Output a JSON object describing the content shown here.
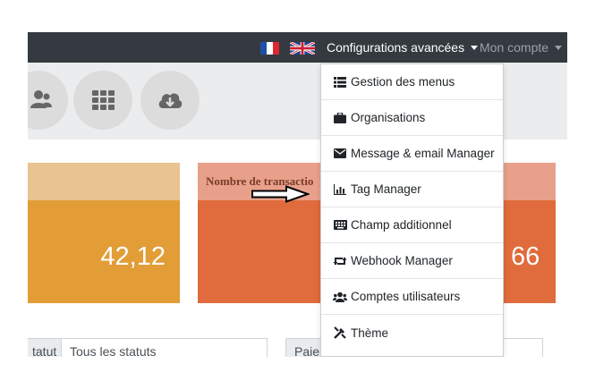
{
  "navbar": {
    "config_label": "Configurations avancées",
    "account_label": "Mon compte"
  },
  "cards": [
    {
      "value": "42,12"
    },
    {
      "title": "Nombre de transactio",
      "value": "66"
    }
  ],
  "filters": {
    "status_label": "tatut",
    "status_value": "Tous les statuts",
    "payment_label": "Paien"
  },
  "menu": {
    "items": [
      {
        "label": "Gestion des menus",
        "icon": "list-icon"
      },
      {
        "label": "Organisations",
        "icon": "briefcase-icon"
      },
      {
        "label": "Message & email Manager",
        "icon": "envelope-icon"
      },
      {
        "label": "Tag Manager",
        "icon": "bar-chart-icon"
      },
      {
        "label": "Champ additionnel",
        "icon": "keyboard-icon"
      },
      {
        "label": "Webhook Manager",
        "icon": "retweet-icon"
      },
      {
        "label": "Comptes utilisateurs",
        "icon": "users-icon"
      },
      {
        "label": "Thème",
        "icon": "tools-icon"
      }
    ]
  },
  "colors": {
    "navbar": "#343a40",
    "card_yellow": "#e29d37",
    "card_yellow_head": "#e8c490",
    "card_orange": "#e06b3c",
    "card_orange_head": "#e8a08a"
  }
}
